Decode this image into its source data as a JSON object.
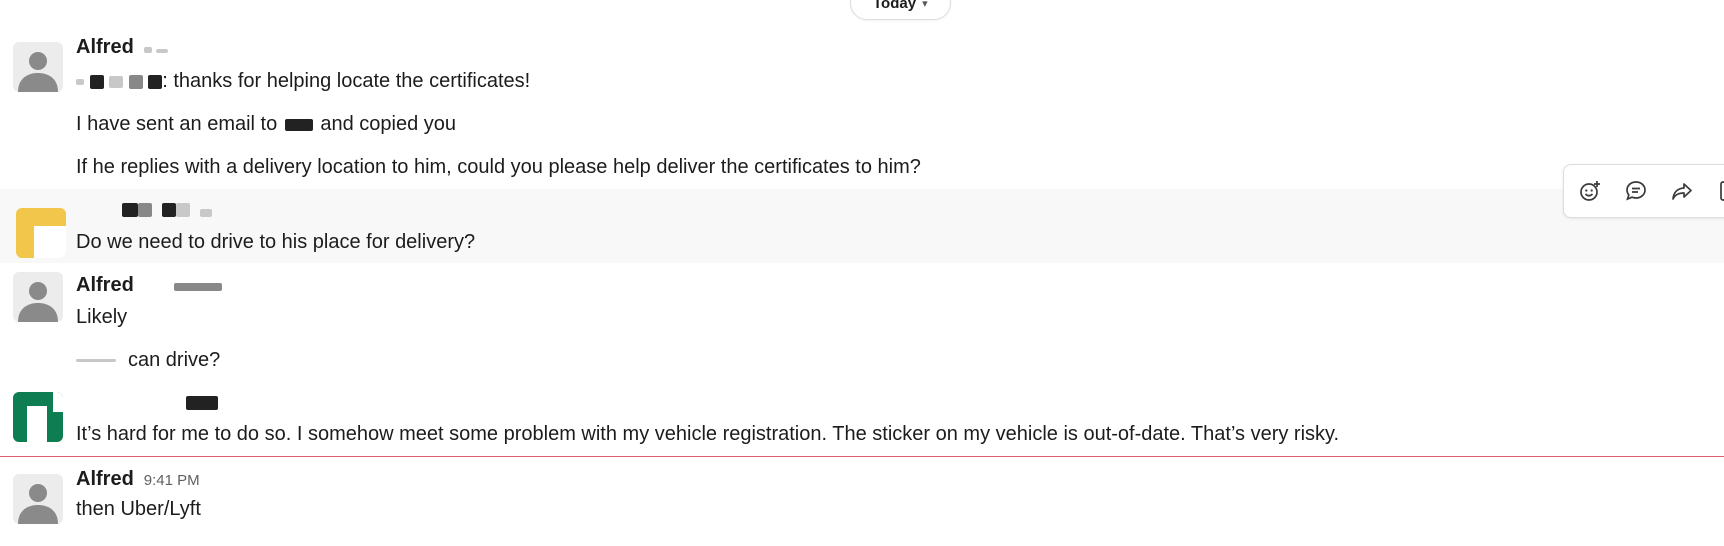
{
  "date_divider": {
    "label": "Today"
  },
  "messages": [
    {
      "sender": "Alfred",
      "lines": [
        ": thanks for helping locate the certificates!",
        "I have sent an email to",
        "and copied you",
        "If he replies with a delivery location to him, could you please help deliver the certificates to him?"
      ]
    },
    {
      "sender": "",
      "lines": [
        "Do we need to drive to his place for delivery?"
      ]
    },
    {
      "sender": "Alfred",
      "lines": [
        "Likely",
        "can drive?"
      ]
    },
    {
      "sender": "",
      "lines": [
        "It’s hard for me to do so. I somehow meet some problem with my vehicle registration. The sticker on my vehicle is out-of-date. That’s very risky."
      ]
    },
    {
      "sender": "Alfred",
      "time": "9:41 PM",
      "lines": [
        "then Uber/Lyft"
      ]
    }
  ],
  "toolbar": {
    "icons": [
      "add-reaction-icon",
      "reply-in-thread-icon",
      "share-icon",
      "more-icon"
    ]
  },
  "colors": {
    "new_line": "#e35b6f",
    "hover_bg": "#f8f8f8",
    "text": "#1d1c1d",
    "muted": "#616061"
  }
}
